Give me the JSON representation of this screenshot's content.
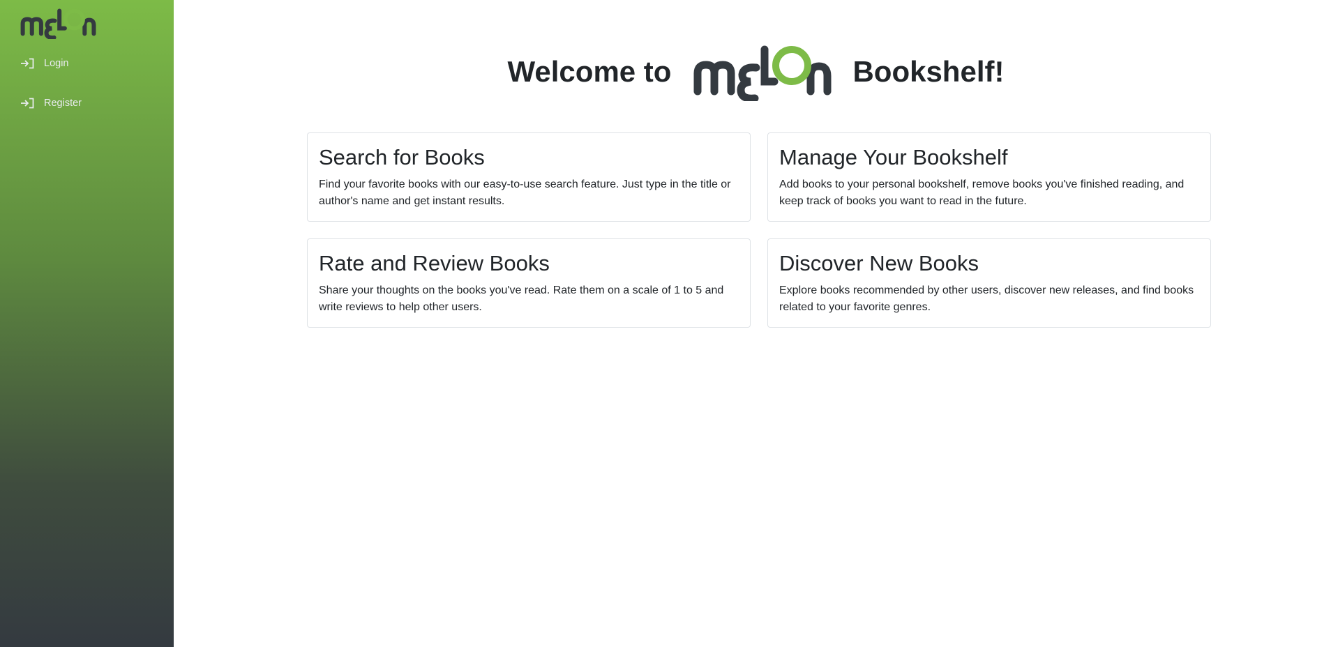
{
  "sidebar": {
    "logo_text": "melon",
    "nav": [
      {
        "label": "Login",
        "icon": "login-icon"
      },
      {
        "label": "Register",
        "icon": "login-icon"
      }
    ]
  },
  "header": {
    "welcome_prefix": "Welcome to",
    "logo_text": "melon",
    "welcome_suffix": "Bookshelf!"
  },
  "features": [
    {
      "title": "Search for Books",
      "text": "Find your favorite books with our easy-to-use search feature. Just type in the title or author's name and get instant results."
    },
    {
      "title": "Manage Your Bookshelf",
      "text": "Add books to your personal bookshelf, remove books you've finished reading, and keep track of books you want to read in the future."
    },
    {
      "title": "Rate and Review Books",
      "text": "Share your thoughts on the books you've read. Rate them on a scale of 1 to 5 and write reviews to help other users."
    },
    {
      "title": "Discover New Books",
      "text": "Explore books recommended by other users, discover new releases, and find books related to your favorite genres."
    }
  ],
  "colors": {
    "brand_green": "#7dbb47",
    "logo_dark": "#343a40",
    "sidebar_bottom": "#343a40"
  }
}
